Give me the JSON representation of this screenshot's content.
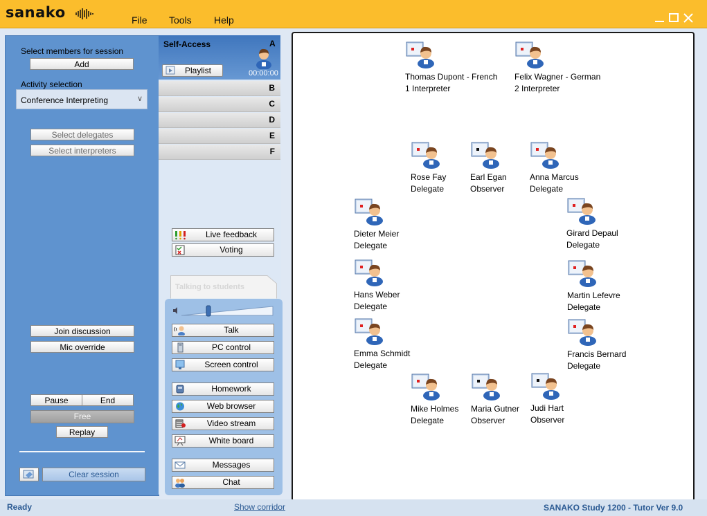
{
  "app": {
    "brand": "sanako",
    "accent": "#fbbd2c",
    "panel_blue": "#5f93cf"
  },
  "menu": [
    "File",
    "Tools",
    "Help"
  ],
  "left": {
    "select_members_label": "Select members for session",
    "add_label": "Add",
    "activity_label": "Activity selection",
    "activity_value": "Conference Interpreting",
    "select_delegates": "Select delegates",
    "select_interpreters": "Select interpreters",
    "join_discussion": "Join discussion",
    "mic_override": "Mic override",
    "pause": "Pause",
    "end": "End",
    "free": "Free",
    "replay": "Replay",
    "clear_session": "Clear session"
  },
  "selfaccess": {
    "title": "Self-Access",
    "letter": "A",
    "playlist": "Playlist",
    "time": "00:00:00"
  },
  "tabs": [
    "B",
    "C",
    "D",
    "E",
    "F"
  ],
  "tools": {
    "live_feedback": "Live feedback",
    "voting": "Voting",
    "talking_to_students": "Talking to students"
  },
  "talk_buttons": [
    "Talk",
    "PC control",
    "Screen control",
    "Homework",
    "Web browser",
    "Video stream",
    "White board",
    "Messages",
    "Chat"
  ],
  "members": [
    {
      "line1": "Thomas Dupont - French",
      "line2": "1 Interpreter",
      "icon": "red-dot"
    },
    {
      "line1": "Felix Wagner - German",
      "line2": "2 Interpreter",
      "icon": "red-dot"
    },
    {
      "line1": "Rose Fay",
      "line2": "Delegate",
      "icon": "red-dot"
    },
    {
      "line1": "Earl Egan",
      "line2": "Observer",
      "icon": "black-dot"
    },
    {
      "line1": "Anna Marcus",
      "line2": "Delegate",
      "icon": "red-dot"
    },
    {
      "line1": "Dieter Meier",
      "line2": "Delegate",
      "icon": "red-dot"
    },
    {
      "line1": "Girard Depaul",
      "line2": "Delegate",
      "icon": "red-dot"
    },
    {
      "line1": "Hans Weber",
      "line2": "Delegate",
      "icon": "red-dot"
    },
    {
      "line1": "Martin Lefevre",
      "line2": "Delegate",
      "icon": "red-dot"
    },
    {
      "line1": "Emma Schmidt",
      "line2": "Delegate",
      "icon": "red-dot"
    },
    {
      "line1": "Francis Bernard",
      "line2": "Delegate",
      "icon": "red-dot"
    },
    {
      "line1": "Mike Holmes",
      "line2": "Delegate",
      "icon": "red-dot"
    },
    {
      "line1": "Maria Gutner",
      "line2": "Observer",
      "icon": "black-dot"
    },
    {
      "line1": "Judi Hart",
      "line2": "Observer",
      "icon": "black-dot"
    }
  ],
  "status": {
    "ready": "Ready",
    "show_corridor": "Show corridor",
    "version": "SANAKO Study 1200 - Tutor Ver 9.0"
  }
}
